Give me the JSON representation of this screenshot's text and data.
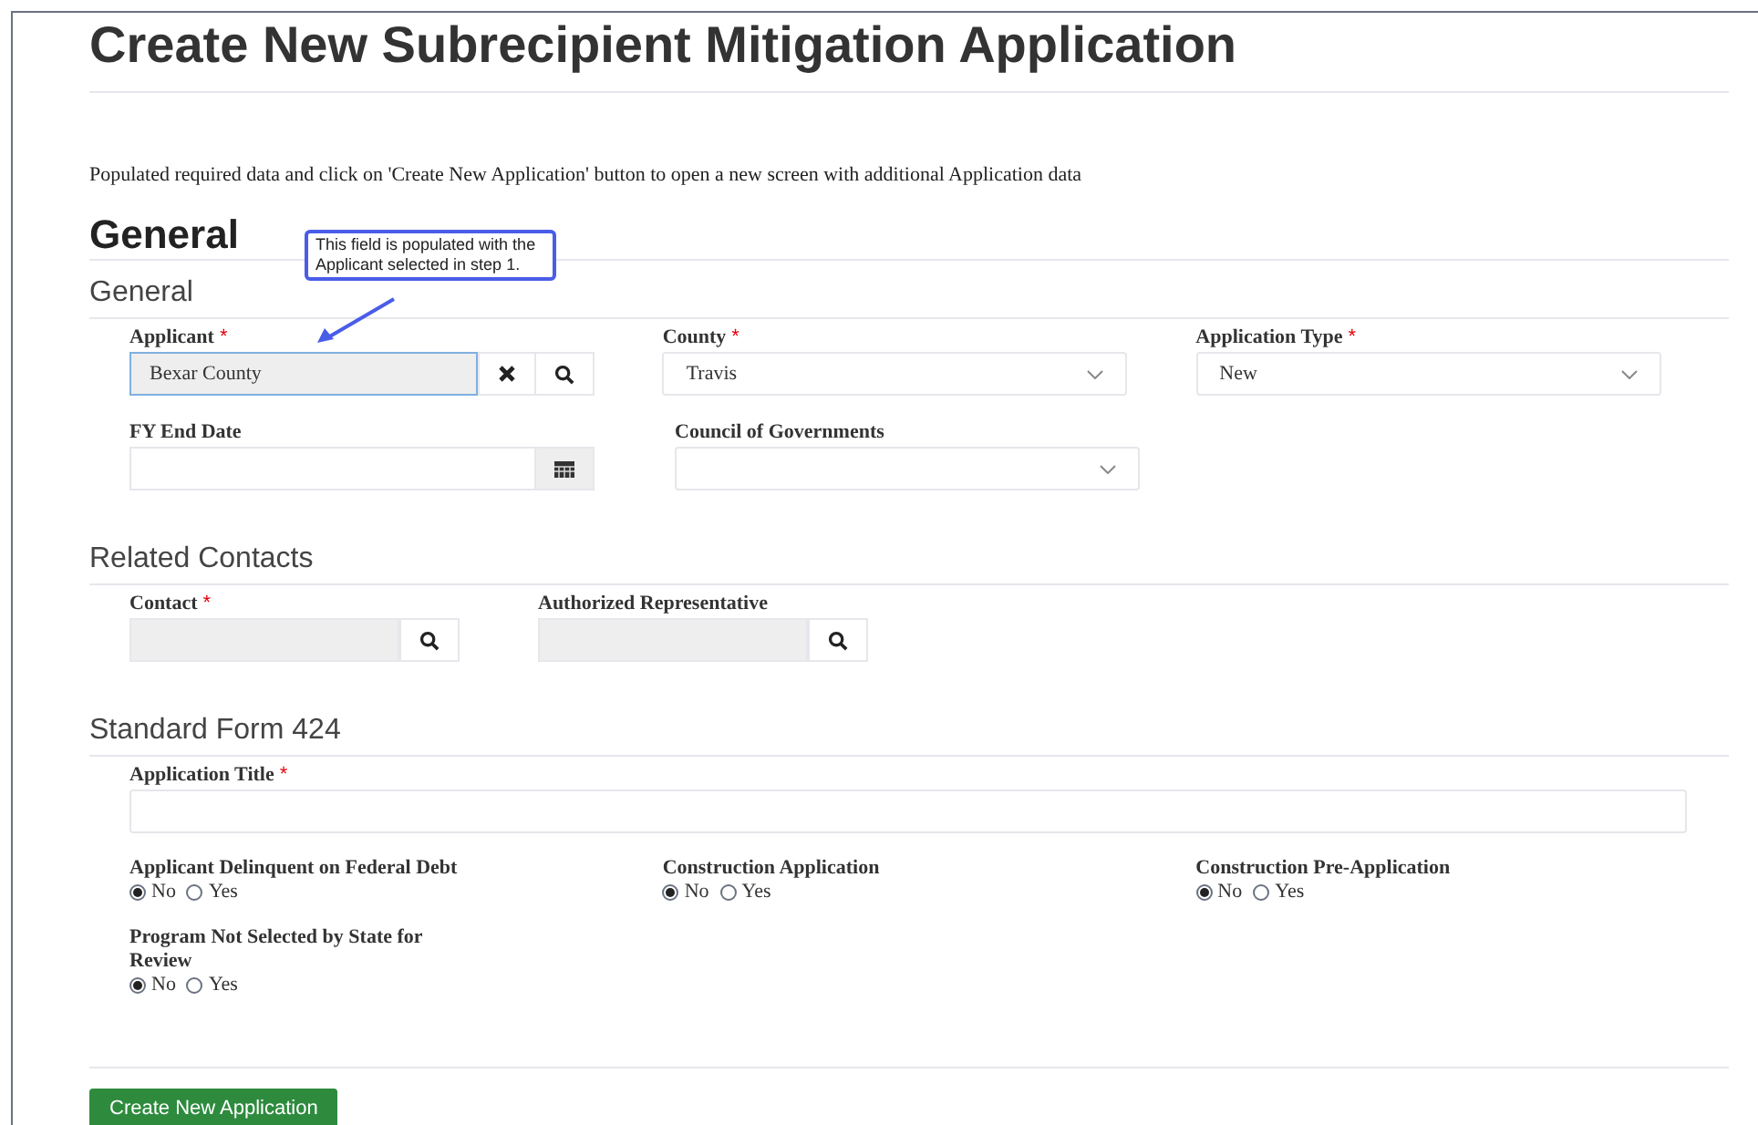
{
  "title": "Create New Subrecipient Mitigation Application",
  "intro": "Populated required data and click on 'Create New Application' button to open a new screen with additional Application data",
  "heading": "General",
  "callout": "This field is populated with the Applicant selected in step 1.",
  "sections": [
    {
      "title": "General",
      "rows": [
        [
          {
            "kind": "lookup",
            "label": "Applicant",
            "required_mark": "*",
            "value": "Bexar County"
          },
          {
            "kind": "select",
            "label": "County",
            "required_mark": "*",
            "value": "Travis"
          },
          {
            "kind": "select",
            "label": "Application Type",
            "required_mark": "*",
            "value": "New"
          }
        ],
        [
          {
            "kind": "date",
            "label": "FY End Date"
          },
          {
            "kind": "select",
            "label": "Council of Governments"
          }
        ]
      ]
    },
    {
      "title": "Related Contacts",
      "rows": [
        [
          {
            "kind": "search",
            "label": "Contact",
            "required_mark": "*"
          },
          {
            "kind": "search",
            "label": "Authorized Representative"
          }
        ]
      ]
    },
    {
      "title": "Standard Form 424",
      "rows": [
        [
          {
            "kind": "text",
            "label": "Application Title",
            "required_mark": "*"
          }
        ],
        [
          {
            "kind": "radio",
            "label": "Applicant Delinquent on Federal Debt",
            "options": [
              {
                "label": "No",
                "selected": true
              },
              {
                "label": "Yes",
                "selected": false
              }
            ]
          },
          {
            "kind": "radio",
            "label": "Construction Application",
            "options": [
              {
                "label": "No",
                "selected": true
              },
              {
                "label": "Yes",
                "selected": false
              }
            ]
          },
          {
            "kind": "radio",
            "label": "Construction Pre-Application",
            "options": [
              {
                "label": "No",
                "selected": true
              },
              {
                "label": "Yes",
                "selected": false
              }
            ]
          }
        ],
        [
          {
            "kind": "radio",
            "label": "Program Not Selected by State for Review",
            "options": [
              {
                "label": "No",
                "selected": true
              },
              {
                "label": "Yes",
                "selected": false
              }
            ]
          }
        ]
      ]
    }
  ],
  "button": "Create New Application"
}
